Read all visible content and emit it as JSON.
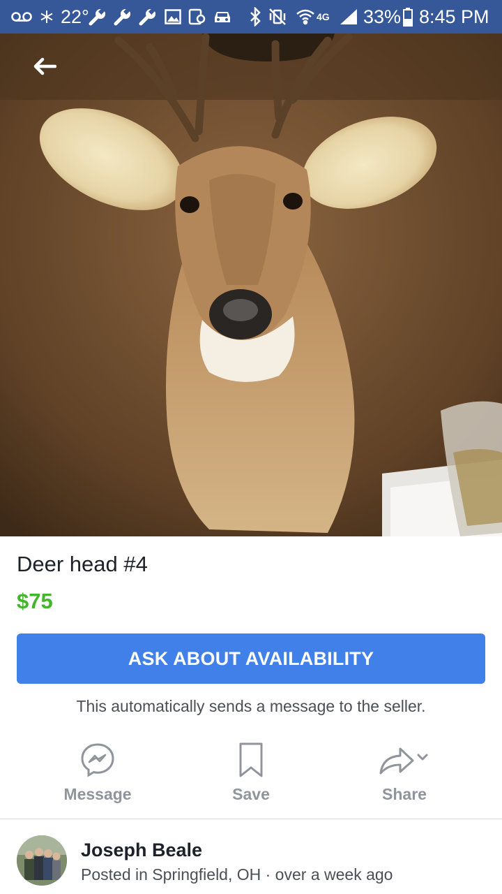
{
  "status_bar": {
    "temperature": "22°",
    "network": "4G",
    "battery": "33%",
    "time": "8:45 PM"
  },
  "listing": {
    "title": "Deer head #4",
    "price": "$75",
    "cta_label": "ASK ABOUT AVAILABILITY",
    "cta_hint": "This automatically sends a message to the seller."
  },
  "actions": [
    {
      "label": "Message",
      "icon": "messenger-icon"
    },
    {
      "label": "Save",
      "icon": "bookmark-icon"
    },
    {
      "label": "Share",
      "icon": "share-icon"
    }
  ],
  "seller": {
    "name": "Joseph Beale",
    "posted": "Posted in Springfield, OH · over a week ago"
  },
  "colors": {
    "status_bar": "#365899",
    "price": "#42b72a",
    "cta": "#4080e8",
    "action_gray": "#90949c"
  }
}
